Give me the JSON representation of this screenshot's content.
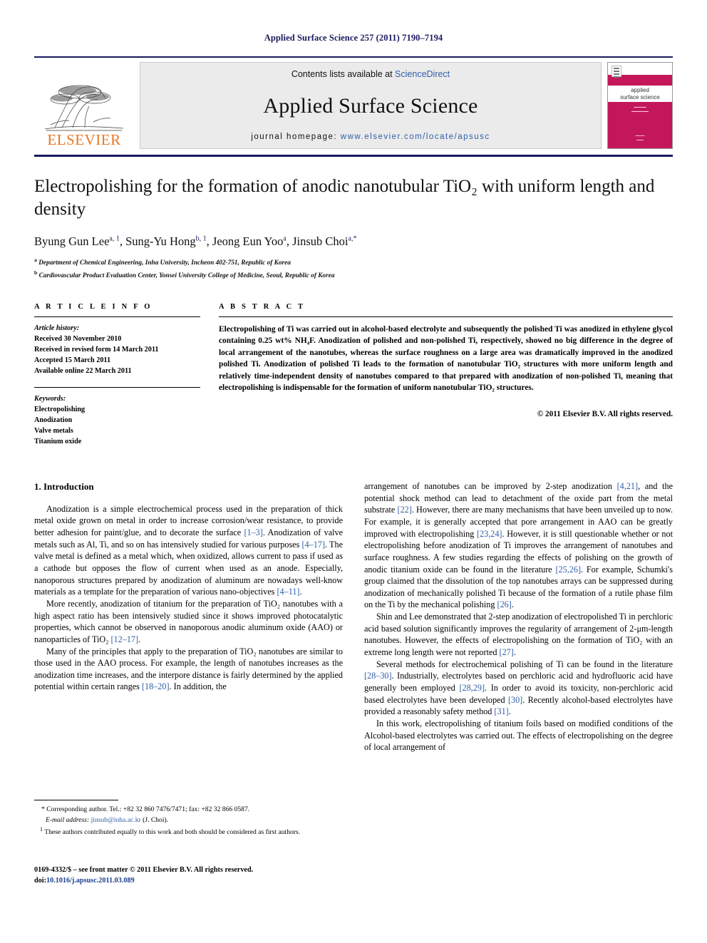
{
  "running_head": "Applied Surface Science 257 (2011) 7190–7194",
  "masthead": {
    "contents_prefix": "Contents lists available at ",
    "sciencedirect": "ScienceDirect",
    "journal_title": "Applied Surface Science",
    "homepage_prefix": "journal homepage:",
    "homepage_url": "www.elsevier.com/locate/apsusc",
    "publisher": "ELSEVIER",
    "cover": {
      "title_line1": "applied",
      "title_line2": "surface science",
      "accent_color": "#c3175a"
    }
  },
  "article": {
    "title": "Electropolishing for the formation of anodic nanotubular TiO₂ with uniform length and density",
    "authors_html": "Byung Gun Lee<sup>a, 1</sup>, Sung-Yu Hong<sup>b, 1</sup>, Jeong Eun Yoo<sup>a</sup>, Jinsub Choi<sup>a,</sup><sup>*</sup>",
    "affiliation_a": "Department of Chemical Engineering, Inha University, Incheon 402-751, Republic of Korea",
    "affiliation_b": "Cardiovascular Product Evaluation Center, Yonsei University College of Medicine, Seoul, Republic of Korea"
  },
  "info": {
    "heading": "A R T I C L E    I N F O",
    "history_label": "Article history:",
    "history": [
      "Received 30 November 2010",
      "Received in revised form 14 March 2011",
      "Accepted 15 March 2011",
      "Available online 22 March 2011"
    ],
    "keywords_label": "Keywords:",
    "keywords": [
      "Electropolishing",
      "Anodization",
      "Valve metals",
      "Titanium oxide"
    ]
  },
  "abstract": {
    "heading": "A B S T R A C T",
    "text": "Electropolishing of Ti was carried out in alcohol-based electrolyte and subsequently the polished Ti was anodized in ethylene glycol containing 0.25 wt% NH₄F. Anodization of polished and non-polished Ti, respectively, showed no big difference in the degree of local arrangement of the nanotubes, whereas the surface roughness on a large area was dramatically improved in the anodized polished Ti. Anodization of polished Ti leads to the formation of nanotubular TiO₂ structures with more uniform length and relatively time-independent density of nanotubes compared to that prepared with anodization of non-polished Ti, meaning that electropolishing is indispensable for the formation of uniform nanotubular TiO₂ structures.",
    "copyright": "© 2011 Elsevier B.V. All rights reserved."
  },
  "body": {
    "section_heading": "1.  Introduction",
    "left_paragraphs": [
      "Anodization is a simple electrochemical process used in the preparation of thick metal oxide grown on metal in order to increase corrosion/wear resistance, to provide better adhesion for paint/glue, and to decorate the surface [1–3]. Anodization of valve metals such as Al, Ti, and so on has intensively studied for various purposes [4–17]. The valve metal is defined as a metal which, when oxidized, allows current to pass if used as a cathode but opposes the flow of current when used as an anode. Especially, nanoporous structures prepared by anodization of aluminum are nowadays well-know materials as a template for the preparation of various nano-objectives [4–11].",
      "More recently, anodization of titanium for the preparation of TiO₂ nanotubes with a high aspect ratio has been intensively studied since it shows improved photocatalytic properties, which cannot be observed in nanoporous anodic aluminum oxide (AAO) or nanoparticles of TiO₂ [12–17].",
      "Many of the principles that apply to the preparation of TiO₂ nanotubes are similar to those used in the AAO process. For example, the length of nanotubes increases as the anodization time increases, and the interpore distance is fairly determined by the applied potential within certain ranges [18–20]. In addition, the"
    ],
    "right_paragraphs": [
      "arrangement of nanotubes can be improved by 2-step anodization [4,21], and the potential shock method can lead to detachment of the oxide part from the metal substrate [22]. However, there are many mechanisms that have been unveiled up to now. For example, it is generally accepted that pore arrangement in AAO can be greatly improved with electropolishing [23,24]. However, it is still questionable whether or not electropolishing before anodization of Ti improves the arrangement of nanotubes and surface roughness. A few studies regarding the effects of polishing on the growth of anodic titanium oxide can be found in the literature [25,26]. For example, Schumki's group claimed that the dissolution of the top nanotubes arrays can be suppressed during anodization of mechanically polished Ti because of the formation of a rutile phase film on the Ti by the mechanical polishing [26].",
      "Shin and Lee demonstrated that 2-step anodization of electropolished Ti in perchloric acid based solution significantly improves the regularity of arrangement of 2-μm-length nanotubes. However, the effects of electropolishing on the formation of TiO₂ with an extreme long length were not reported [27].",
      "Several methods for electrochemical polishing of Ti can be found in the literature [28–30]. Industrially, electrolytes based on perchloric acid and hydrofluoric acid have generally been employed [28,29]. In order to avoid its toxicity, non-perchloric acid based electrolytes have been developed [30]. Recently alcohol-based electrolytes have provided a reasonably safety method [31].",
      "In this work, electropolishing of titanium foils based on modified conditions of the Alcohol-based electrolytes was carried out. The effects of electropolishing on the degree of local arrangement of"
    ]
  },
  "footnotes": {
    "corresponding": "* Corresponding author. Tel.: +82 32 860 7476/7471; fax: +82 32 866 0587.",
    "email_label": "E-mail address:",
    "email": "jinsub@inha.ac.kr",
    "email_suffix": "(J. Choi).",
    "equal_contrib": "These authors contributed equally to this work and both should be considered as first authors.",
    "equal_contrib_marker": "1"
  },
  "imprint": {
    "frontmatter": "0169-4332/$ – see front matter © 2011 Elsevier B.V. All rights reserved.",
    "doi_label": "doi:",
    "doi": "10.1016/j.apsusc.2011.03.089"
  }
}
